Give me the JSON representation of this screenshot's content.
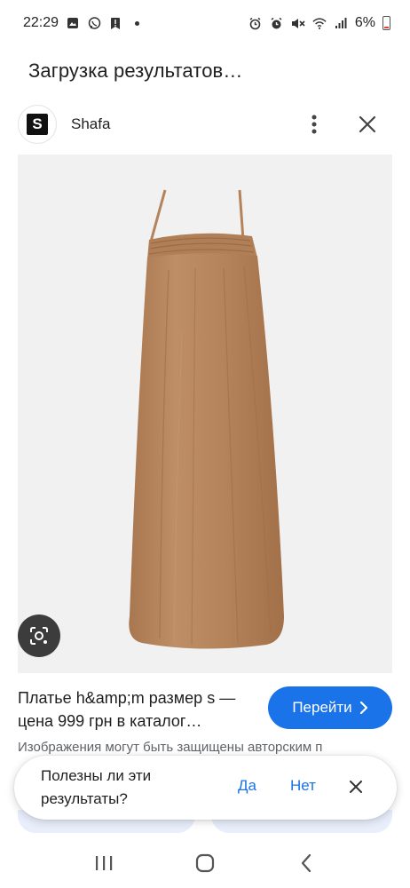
{
  "status_bar": {
    "time": "22:29",
    "battery": "6%"
  },
  "page": {
    "loading_title": "Загрузка результатов…"
  },
  "source": {
    "logo_letter": "S",
    "name": "Shafa"
  },
  "product_image": {
    "description_icon": "dress-image",
    "background_color": "#f1f1f1",
    "dress_color": "#b88760"
  },
  "result": {
    "title": "Платье h&amp;m размер s — цена 999 грн в каталог…",
    "go_button_label": "Перейти",
    "copyright_note": "Изображения могут быть защищены авторским п"
  },
  "feedback": {
    "question": "Полезны ли эти результаты?",
    "yes_label": "Да",
    "no_label": "Нет"
  },
  "colors": {
    "accent": "#1a73e8",
    "lens_button": "#3c3c3c"
  },
  "icons": [
    "photo-icon",
    "viber-icon",
    "save-icon",
    "alarm-icon",
    "mute-icon",
    "wifi-icon",
    "signal-icon",
    "battery-icon",
    "more-vert-icon",
    "close-icon",
    "lens-icon",
    "chevron-right-icon",
    "recents-icon",
    "home-icon",
    "back-icon"
  ]
}
